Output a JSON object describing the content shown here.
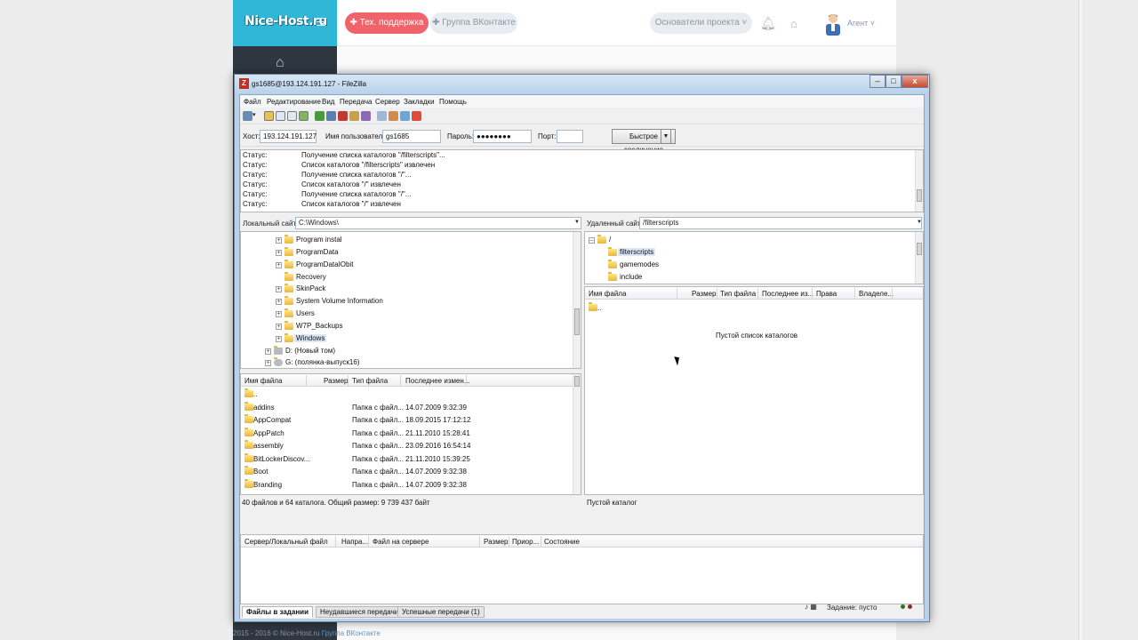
{
  "web": {
    "logo": "Nice-Host.ru",
    "support_btn": "Тех. поддержка",
    "vk_btn": "Группа ВКонтакте",
    "founders_btn": "Основатели проекта",
    "agent_label": "Агент",
    "footer_text": "2015 - 2016 © Nice-Host.ru",
    "footer_link": "Группа ВКонтакте"
  },
  "window": {
    "title": "gs1685@193.124.191.127 - FileZilla",
    "min": "–",
    "max": "□",
    "close": "x"
  },
  "menu": [
    "Файл",
    "Редактирование",
    "Вид",
    "Передача",
    "Сервер",
    "Закладки",
    "Помощь"
  ],
  "quick": {
    "host_label": "Хост:",
    "host_value": "193.124.191.127",
    "user_label": "Имя пользователя",
    "user_value": "gs1685",
    "pass_label": "Пароль:",
    "pass_value": "●●●●●●●●",
    "port_label": "Порт:",
    "port_value": "",
    "connect_btn": "Быстрое соединение"
  },
  "log": [
    {
      "label": "Статус:",
      "text": "Получение списка каталогов \"/filterscripts\"..."
    },
    {
      "label": "Статус:",
      "text": "Список каталогов \"/filterscripts\" извлечен"
    },
    {
      "label": "Статус:",
      "text": "Получение списка каталогов \"/\"..."
    },
    {
      "label": "Статус:",
      "text": "Список каталогов \"/\" извлечен"
    },
    {
      "label": "Статус:",
      "text": "Получение списка каталогов \"/\"..."
    },
    {
      "label": "Статус:",
      "text": "Список каталогов \"/\" извлечен"
    }
  ],
  "local": {
    "site_label": "Локальный сайт:",
    "site_path": "C:\\Windows\\",
    "tree": [
      "Program instal",
      "ProgramData",
      "ProgramDataIObit",
      "Recovery",
      "SkinPack",
      "System Volume Information",
      "Users",
      "W7P_Backups",
      "Windows",
      "D: (Новый том)",
      "G: (полянка-выпуск16)"
    ],
    "headers": [
      "Имя файла",
      "Размер",
      "Тип файла",
      "Последнее измен..."
    ],
    "files": [
      {
        "name": "..",
        "type": "",
        "date": ""
      },
      {
        "name": "addins",
        "type": "Папка с файл...",
        "date": "14.07.2009 9:32:39"
      },
      {
        "name": "AppCompat",
        "type": "Папка с файл...",
        "date": "18.09.2015 17:12:12"
      },
      {
        "name": "AppPatch",
        "type": "Папка с файл...",
        "date": "21.11.2010 15:28:41"
      },
      {
        "name": "assembly",
        "type": "Папка с файл...",
        "date": "23.09.2016 16:54:14"
      },
      {
        "name": "BitLockerDiscov...",
        "type": "Папка с файл...",
        "date": "21.11.2010 15:39:25"
      },
      {
        "name": "Boot",
        "type": "Папка с файл...",
        "date": "14.07.2009 9:32:38"
      },
      {
        "name": "Branding",
        "type": "Папка с файл...",
        "date": "14.07.2009 9:32:38"
      }
    ],
    "status": "40 файлов и 64 каталога. Общий размер: 9 739 437 байт"
  },
  "remote": {
    "site_label": "Удаленный сайт:",
    "site_path": "/filterscripts",
    "tree": [
      "/",
      "filterscripts",
      "gamemodes",
      "include"
    ],
    "headers": [
      "Имя файла",
      "Размер",
      "Тип файла",
      "Последнее из...",
      "Права",
      "Владеле..."
    ],
    "parent": "..",
    "empty_text": "Пустой список каталогов",
    "status": "Пустой каталог"
  },
  "queue": {
    "headers": [
      "Сервер/Локальный файл",
      "Напра...",
      "Файл на сервере",
      "Размер",
      "Приор...",
      "Состояние"
    ]
  },
  "tabs": [
    "Файлы в задании",
    "Неудавшиеся передачи",
    "Успешные передачи (1)"
  ],
  "statusbar": {
    "queue": "Задание: пусто"
  },
  "colors": {
    "accent": "#30b7d8",
    "support": "#f0636b",
    "sidebar": "#2e3640"
  }
}
